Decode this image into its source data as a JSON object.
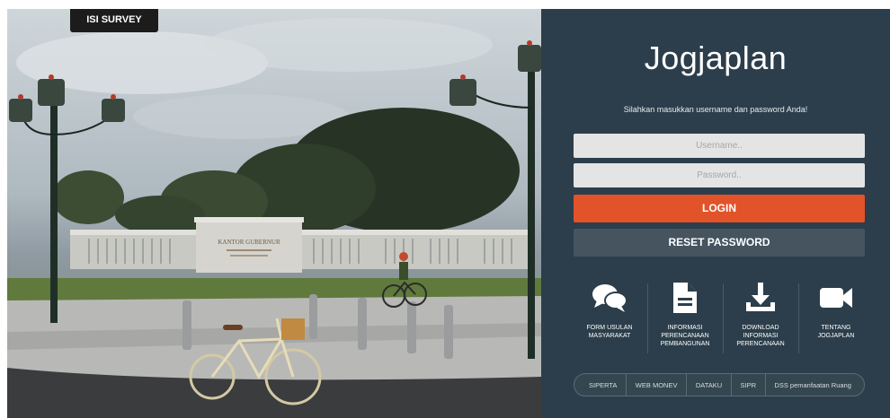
{
  "survey_tab": {
    "label": "ISI SURVEY"
  },
  "login_panel": {
    "title": "Jogjaplan",
    "subtitle": "Silahkan masukkan username dan password Anda!",
    "username_placeholder": "Username..",
    "password_placeholder": "Password..",
    "login_label": "LOGIN",
    "reset_label": "RESET PASSWORD"
  },
  "features": [
    {
      "icon": "chat-bubbles-icon",
      "line1": "FORM USULAN",
      "line2": "MASYARAKAT",
      "line3": ""
    },
    {
      "icon": "document-icon",
      "line1": "INFORMASI",
      "line2": "PERENCANAAN",
      "line3": "PEMBANGUNAN"
    },
    {
      "icon": "download-icon",
      "line1": "DOWNLOAD",
      "line2": "INFORMASI",
      "line3": "PERENCANAAN"
    },
    {
      "icon": "video-camera-icon",
      "line1": "TENTANG",
      "line2": "JOGJAPLAN",
      "line3": ""
    }
  ],
  "bottom_links": [
    "SIPERTA",
    "WEB MONEV",
    "DATAKU",
    "SIPR",
    "DSS pemanfaatan Ruang"
  ],
  "photo_sign": {
    "line1": "KANTOR GUBERNUR"
  },
  "colors": {
    "panel_bg": "#2c3e4b",
    "login_button": "#e2532a",
    "reset_button": "#45545f",
    "input_bg": "#e4e4e4",
    "survey_tab_bg": "#1c1c1c"
  }
}
